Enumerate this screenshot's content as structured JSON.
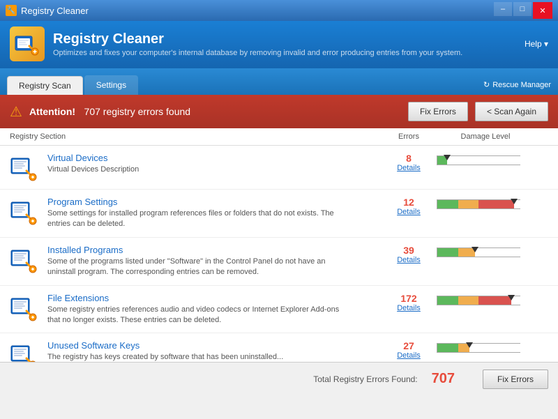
{
  "titleBar": {
    "title": "Registry Cleaner",
    "icon": "🔧",
    "minimize": "–",
    "maximize": "□",
    "close": "✕"
  },
  "header": {
    "appTitle": "Registry Cleaner",
    "subtitle": "Optimizes and fixes your computer's internal database by removing invalid and error producing entries from your system.",
    "helpLabel": "Help ▾"
  },
  "tabs": [
    {
      "id": "registry-scan",
      "label": "Registry Scan",
      "active": true
    },
    {
      "id": "settings",
      "label": "Settings",
      "active": false
    }
  ],
  "rescueManager": "Rescue Manager",
  "alert": {
    "icon": "⚠",
    "boldText": "Attention!",
    "message": "707 registry errors found",
    "fixErrors": "Fix Errors",
    "scanAgain": "< Scan Again"
  },
  "columns": {
    "section": "Registry Section",
    "errors": "Errors",
    "damage": "Damage Level"
  },
  "items": [
    {
      "title": "Virtual Devices",
      "desc": "Virtual Devices Description",
      "errors": "8",
      "detailsLabel": "Details",
      "damageLevel": 0.12,
      "damageColor": "green"
    },
    {
      "title": "Program Settings",
      "desc": "Some settings for installed program references files or folders that do not exists. The entries can be deleted.",
      "errors": "12",
      "detailsLabel": "Details",
      "damageLevel": 0.92,
      "damageColor": "red"
    },
    {
      "title": "Installed Programs",
      "desc": "Some of the programs listed under \"Software\" in the Control Panel do not have an uninstall program. The corresponding entries can be removed.",
      "errors": "39",
      "detailsLabel": "Details",
      "damageLevel": 0.45,
      "damageColor": "yellow"
    },
    {
      "title": "File Extensions",
      "desc": "Some registry entries references audio and video codecs or Internet Explorer Add-ons that no longer exists. These entries can be deleted.",
      "errors": "172",
      "detailsLabel": "Details",
      "damageLevel": 0.88,
      "damageColor": "red"
    },
    {
      "title": "Unused Software Keys",
      "desc": "The registry has keys created by software that has been uninstalled...",
      "errors": "27",
      "detailsLabel": "Details",
      "damageLevel": 0.38,
      "damageColor": "yellow"
    }
  ],
  "footer": {
    "label": "Total Registry Errors Found:",
    "count": "707",
    "fixErrors": "Fix Errors"
  }
}
